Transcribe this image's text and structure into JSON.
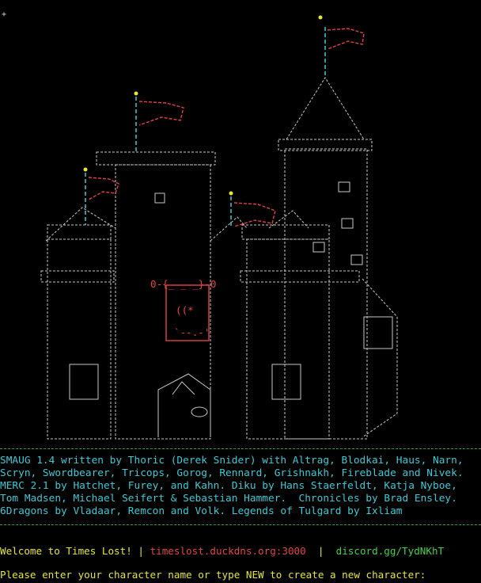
{
  "login_screen": {
    "credits": [
      "SMAUG 1.4 written by Thoric (Derek Snider) with Altrag, Blodkai, Haus, Narn,",
      "Scryn, Swordbearer, Tricops, Gorog, Rennard, Grishnakh, Fireblade and Nivek.",
      "MERC 2.1 by Hatchet, Furey, and Kahn. Diku by Hans Staerfeldt, Katja Nyboe,",
      "Tom Madsen, Michael Seifert & Sebastian Hammer.  Chronicles by Brad Ensley.",
      "6Dragons by Vladaar, Remcon and Volk. Legends of Tulgard by Ixliam"
    ],
    "welcome": "Welcome to Times Lost!",
    "separator_1": " | ",
    "host": "timeslost.duckdns.org:3000",
    "separator_2": "  |  ",
    "discord": "discord.gg/TydNKhT",
    "prompt": "Please enter your character name or type NEW to create a new character:"
  },
  "colors": {
    "background": "#000000",
    "art": "#c8c8c8",
    "flag": "#e04444",
    "pole": "#3fc9d6",
    "finial": "#e6e63a",
    "credits": "#3fc9d6",
    "divider": "#2f9e3a",
    "welcome": "#e6e63a",
    "host": "#e04444",
    "discord": "#44d044",
    "prompt": "#e6e63a"
  }
}
